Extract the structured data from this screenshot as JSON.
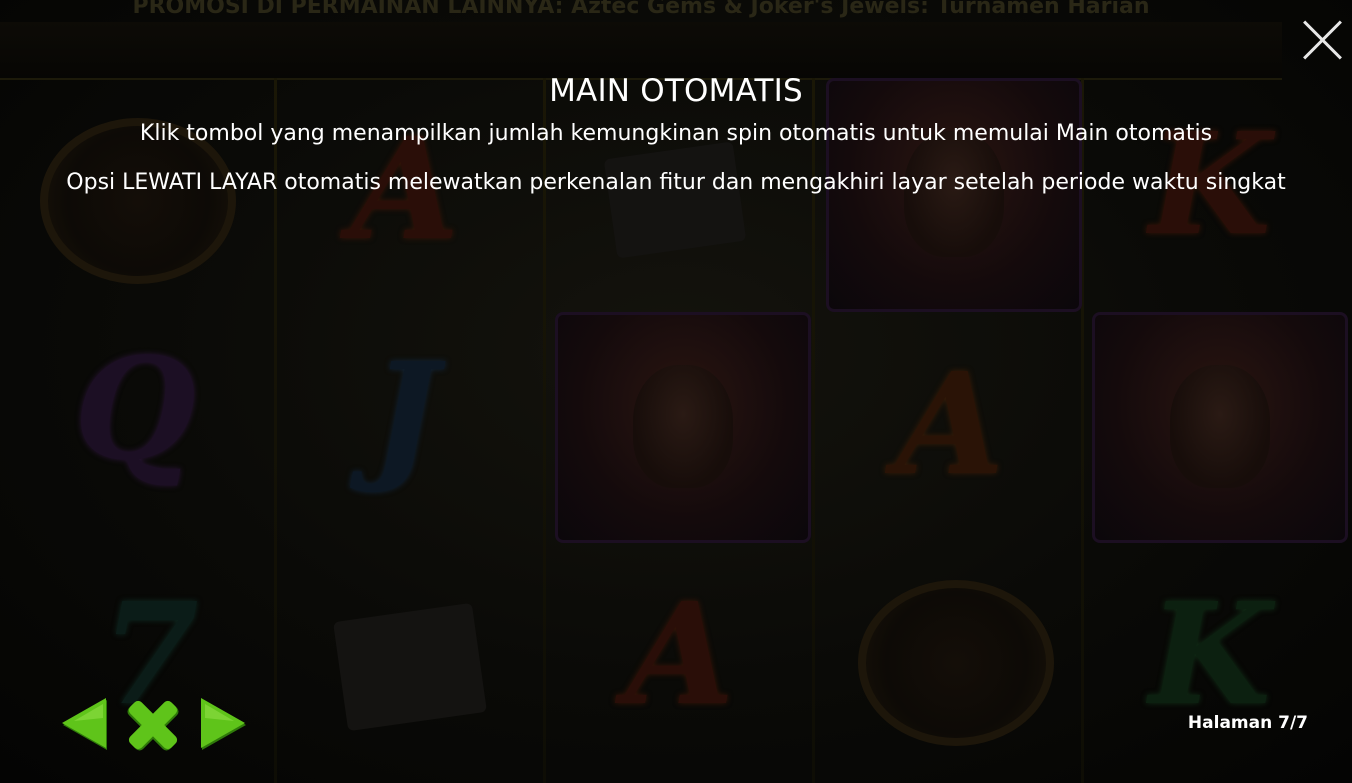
{
  "background": {
    "promo_banner": "PROMOSI DI PERMAINAN LAINNYA: Aztec Gems & Joker's Jewels: Turnamen Harian",
    "reel_symbols": [
      "A",
      "Q",
      "J",
      "A",
      "7",
      "A",
      "K",
      "K"
    ]
  },
  "dialog": {
    "title": "MAIN OTOMATIS",
    "line1": "Klik tombol yang menampilkan jumlah kemungkinan spin otomatis untuk memulai Main otomatis",
    "line2": "Opsi LEWATI LAYAR otomatis melewatkan perkenalan fitur dan mengakhiri layar setelah periode waktu singkat"
  },
  "navigation": {
    "prev_icon": "triangle-left-icon",
    "close_icon": "cross-icon",
    "next_icon": "triangle-right-icon",
    "page_label": "Halaman 7/7"
  },
  "colors": {
    "nav_green": "#5fc41a",
    "nav_green_dark": "#2f7a0a",
    "text": "#ffffff",
    "background": "#0a0a07"
  }
}
